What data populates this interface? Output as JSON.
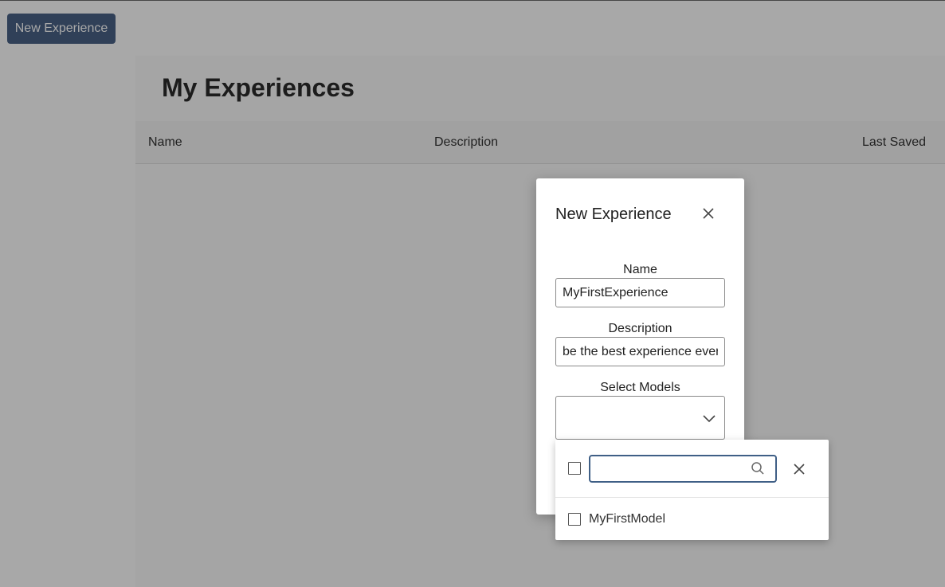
{
  "toolbar": {
    "new_experience_label": "New Experience"
  },
  "main": {
    "title": "My Experiences",
    "table": {
      "columns": [
        "Name",
        "Description",
        "Last Saved"
      ]
    }
  },
  "modal": {
    "title": "New Experience",
    "close_icon": "close-icon",
    "name_label": "Name",
    "name_value": "MyFirstExperience",
    "description_label": "Description",
    "description_value": "be the best experience ever",
    "models_label": "Select Models",
    "models_chevron_icon": "chevron-down-icon"
  },
  "dropdown": {
    "search_value": "",
    "search_icon": "search-icon",
    "clear_icon": "close-icon",
    "options": [
      {
        "label": "MyFirstModel",
        "checked": false
      }
    ]
  },
  "colors": {
    "primary_button": "#4a6286",
    "focus_border": "#3f5f86",
    "overlay": "rgba(0,0,0,0.34)"
  }
}
